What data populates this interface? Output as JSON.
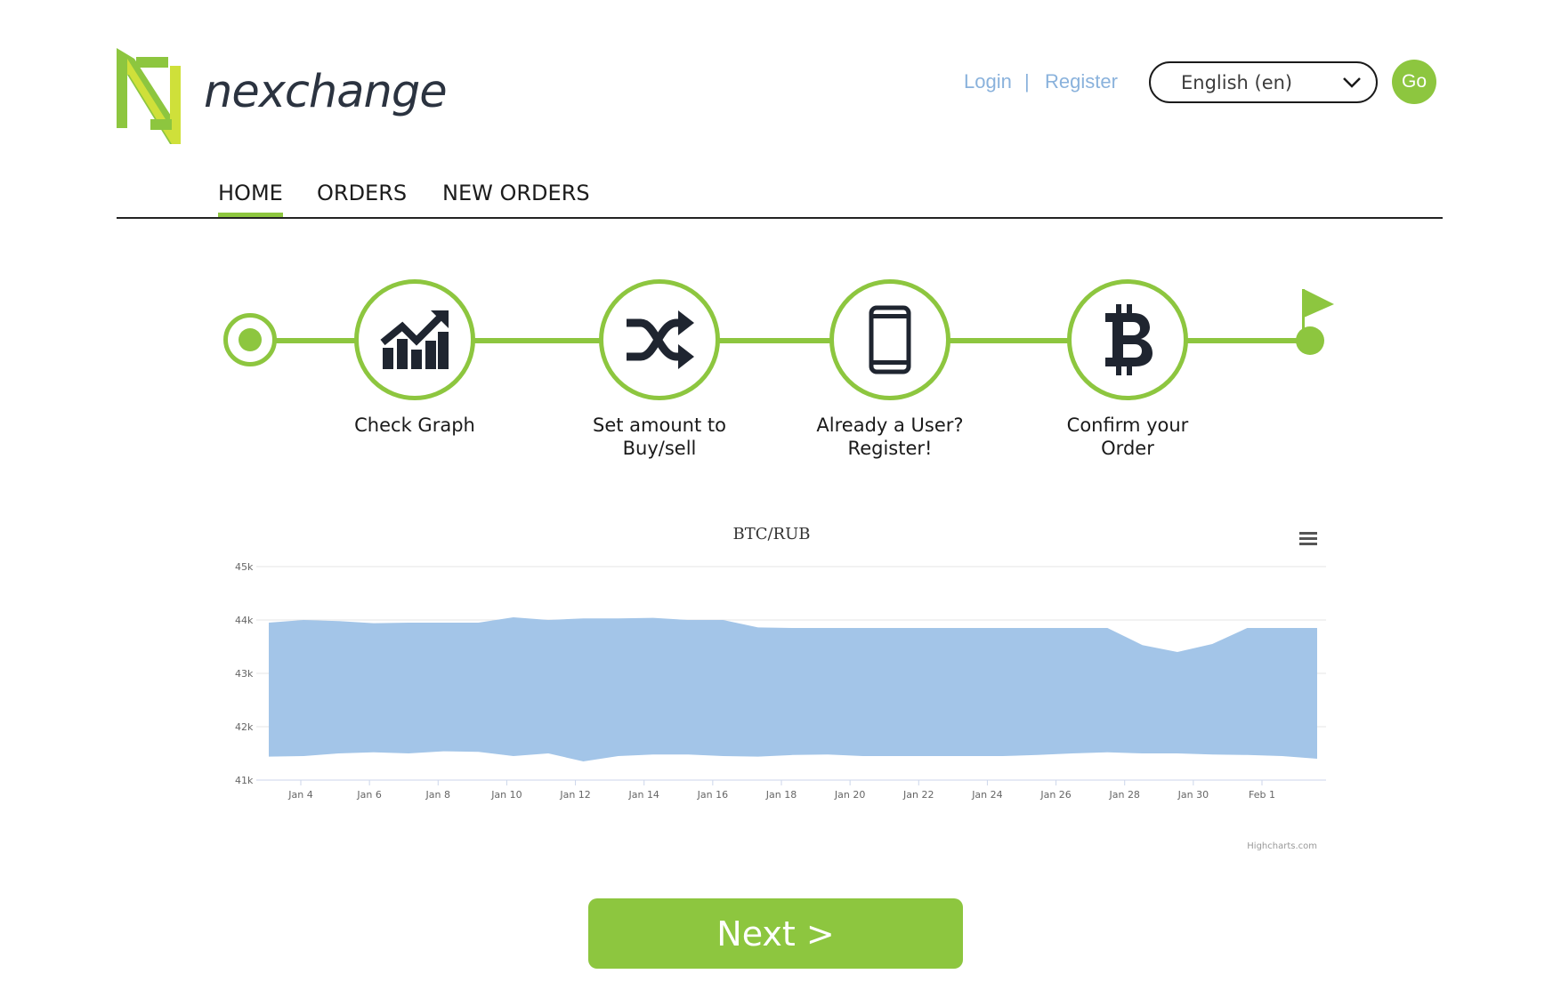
{
  "brand": {
    "name": "nexchange",
    "logo_icon": "nexchange-logo-icon",
    "accent_color": "#8dc63f"
  },
  "header": {
    "login_label": "Login",
    "separator": "|",
    "register_label": "Register",
    "language": {
      "selected": "English (en)"
    },
    "go_label": "Go"
  },
  "nav": {
    "items": [
      {
        "label": "HOME",
        "active": true
      },
      {
        "label": "ORDERS",
        "active": false
      },
      {
        "label": "NEW ORDERS",
        "active": false
      }
    ]
  },
  "steps": [
    {
      "label_line1": "Check Graph",
      "label_line2": "",
      "icon": "chart-growth-icon"
    },
    {
      "label_line1": "Set amount to",
      "label_line2": "Buy/sell",
      "icon": "shuffle-icon"
    },
    {
      "label_line1": "Already a User?",
      "label_line2": "Register!",
      "icon": "mobile-phone-icon"
    },
    {
      "label_line1": "Confirm your",
      "label_line2": "Order",
      "icon": "bitcoin-icon"
    }
  ],
  "chart_data": {
    "type": "area",
    "title": "BTC/RUB",
    "xlabel": "",
    "ylabel": "",
    "ylim": [
      41000,
      45000
    ],
    "y_ticks": [
      "41k",
      "42k",
      "43k",
      "44k",
      "45k"
    ],
    "x_ticks": [
      "Jan 4",
      "Jan 6",
      "Jan 8",
      "Jan 10",
      "Jan 12",
      "Jan 14",
      "Jan 16",
      "Jan 18",
      "Jan 20",
      "Jan 22",
      "Jan 24",
      "Jan 26",
      "Jan 28",
      "Jan 30",
      "Feb 1"
    ],
    "grid": true,
    "series": [
      {
        "color": "#a3c5e8",
        "x": [
          "Jan 3",
          "Jan 4",
          "Jan 5",
          "Jan 6",
          "Jan 7",
          "Jan 8",
          "Jan 9",
          "Jan 10",
          "Jan 11",
          "Jan 12",
          "Jan 13",
          "Jan 14",
          "Jan 15",
          "Jan 16",
          "Jan 17",
          "Jan 18",
          "Jan 19",
          "Jan 20",
          "Jan 21",
          "Jan 22",
          "Jan 23",
          "Jan 24",
          "Jan 25",
          "Jan 26",
          "Jan 27",
          "Jan 28",
          "Jan 29",
          "Jan 30",
          "Jan 31",
          "Feb 1",
          "Feb 2"
        ],
        "high": [
          43950,
          44000,
          43980,
          43940,
          43950,
          43950,
          43950,
          44050,
          44000,
          44030,
          44030,
          44040,
          44000,
          44000,
          43860,
          43850,
          43850,
          43850,
          43850,
          43850,
          43850,
          43850,
          43850,
          43850,
          43850,
          43530,
          43400,
          43550,
          43850,
          43850,
          43850
        ],
        "low": [
          41440,
          41450,
          41500,
          41520,
          41500,
          41540,
          41530,
          41450,
          41500,
          41350,
          41450,
          41480,
          41480,
          41450,
          41440,
          41470,
          41480,
          41450,
          41450,
          41450,
          41450,
          41450,
          41470,
          41500,
          41520,
          41500,
          41500,
          41480,
          41470,
          41450,
          41400
        ]
      }
    ],
    "credits": "Highcharts.com"
  },
  "next_button": {
    "label": "Next >"
  }
}
